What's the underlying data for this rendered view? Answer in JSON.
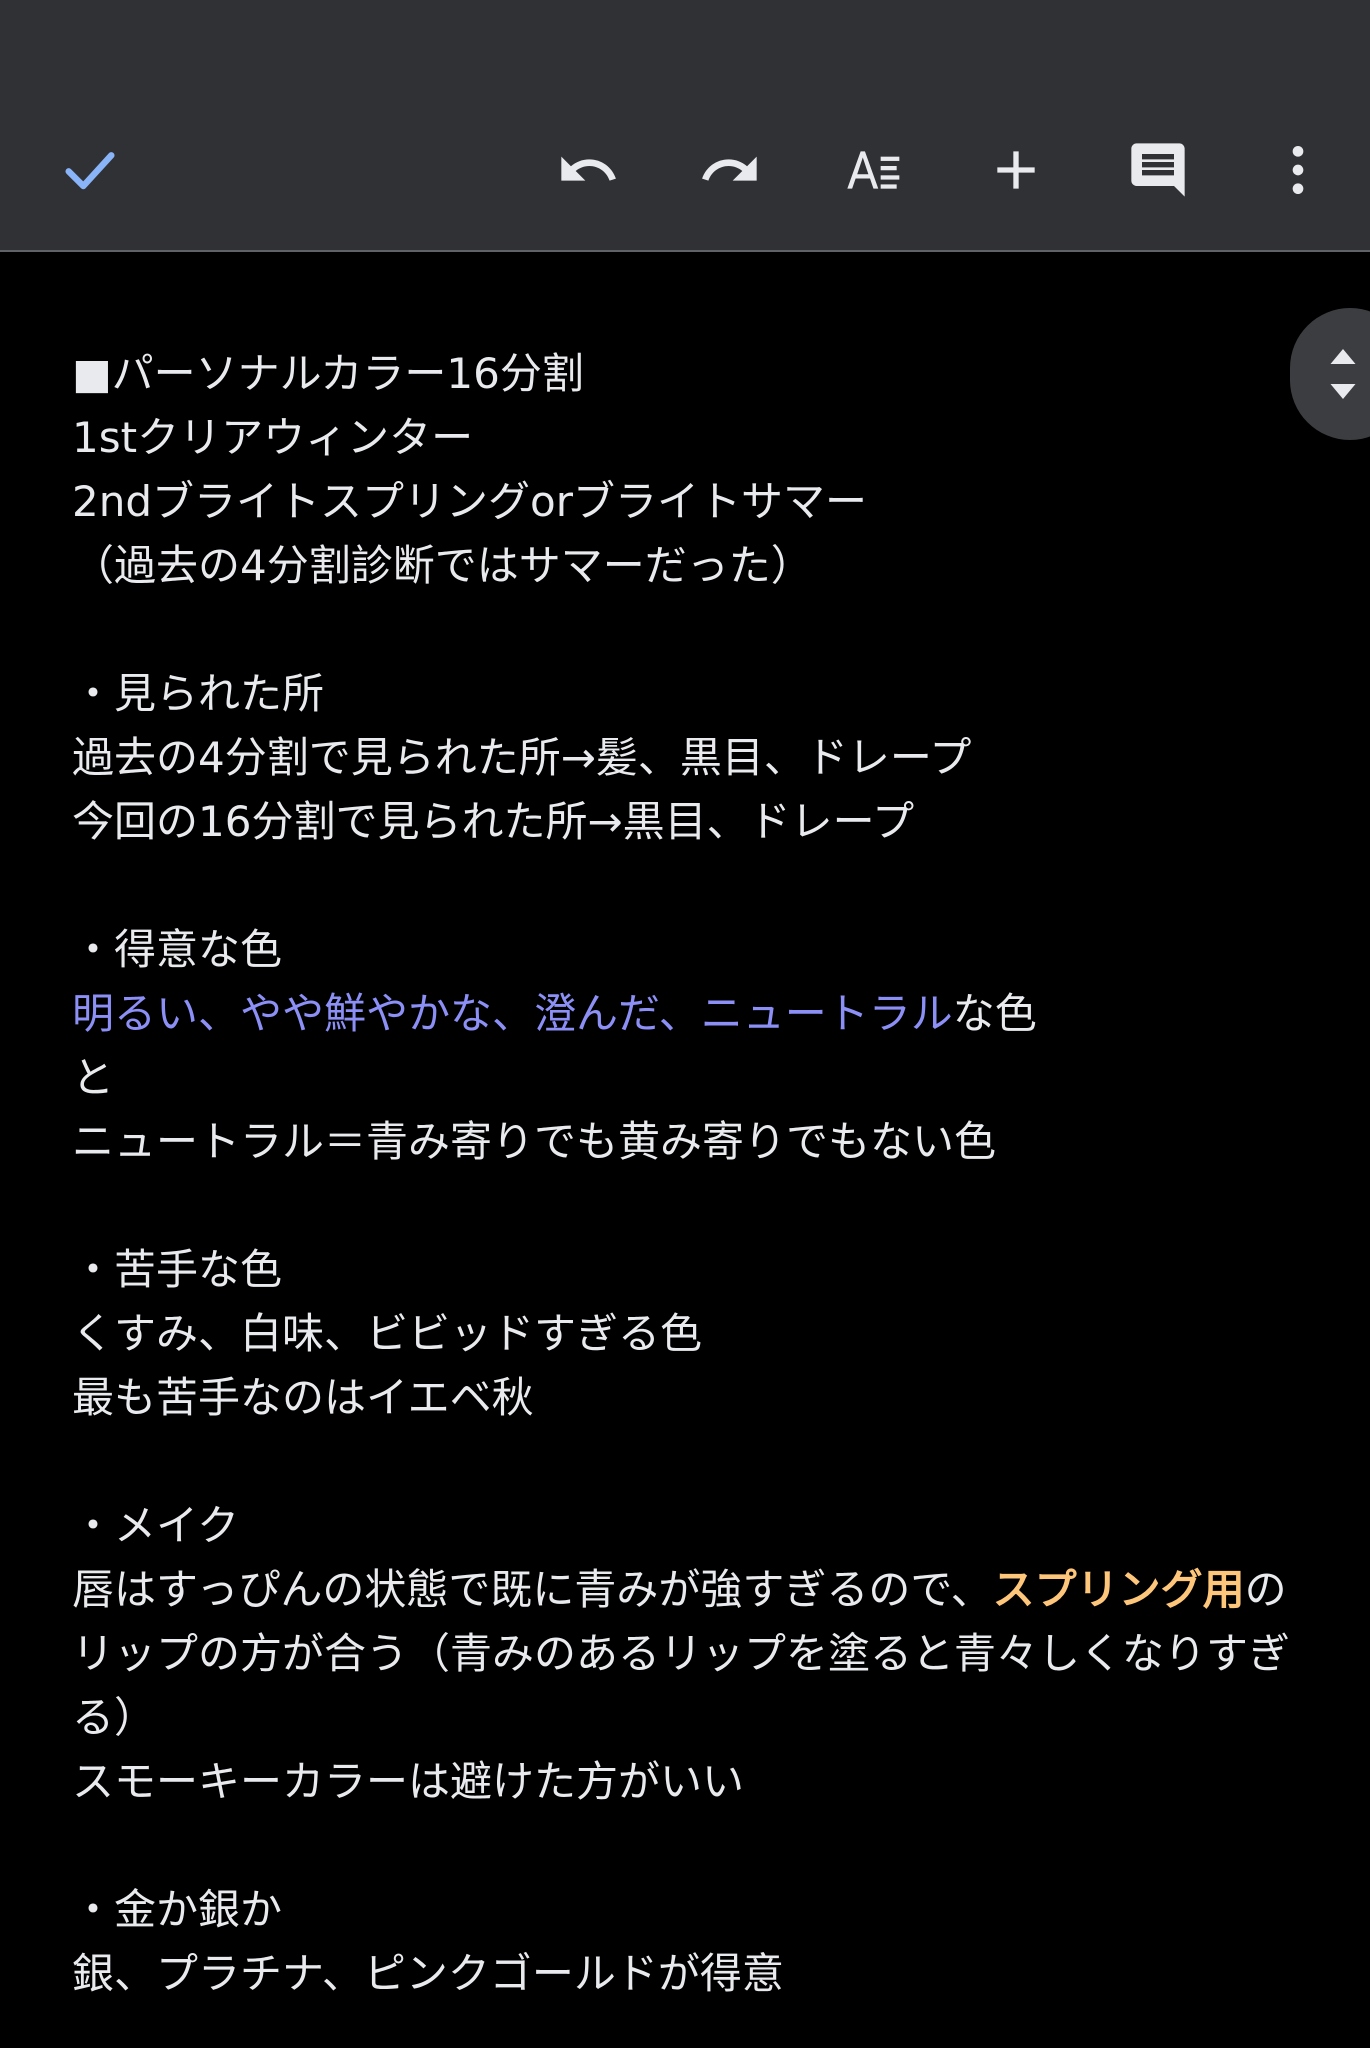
{
  "toolbar": {
    "icons": [
      "check-icon",
      "undo-icon",
      "redo-icon",
      "text-format-icon",
      "add-icon",
      "comment-icon",
      "more-vert-icon"
    ],
    "accent": "#8ab4f8"
  },
  "doc": {
    "l1": "■パーソナルカラー16分割",
    "l2": "1stクリアウィンター",
    "l3": "2ndブライトスプリングorブライトサマー",
    "l4": "（過去の4分割診断ではサマーだった）",
    "l5": "・見られた所",
    "l6": "過去の4分割で見られた所→髪、黒目、ドレープ",
    "l7": "今回の16分割で見られた所→黒目、ドレープ",
    "l8": "・得意な色",
    "l9_colored": "明るい、やや鮮やかな、澄んだ、ニュートラル",
    "l9_rest": "な色",
    "l10": "と",
    "l11": "ニュートラル＝青み寄りでも黄み寄りでもない色",
    "l12": "・苦手な色",
    "l13": "くすみ、白味、ビビッドすぎる色",
    "l14": "最も苦手なのはイエベ秋",
    "l15": "・メイク",
    "l16_a": "唇はすっぴんの状態で既に青みが強すぎるので、",
    "l16_hl": "スプリング用",
    "l16_b": "のリップの方が合う（青みのあるリップを塗ると青々しくなりすぎる）",
    "l17": "スモーキーカラーは避けた方がいい",
    "l18": "・金か銀か",
    "l19": "銀、プラチナ、ピンクゴールドが得意"
  },
  "colors": {
    "blue_text": "#8c8ff5",
    "highlight_text": "#fdc67a"
  }
}
